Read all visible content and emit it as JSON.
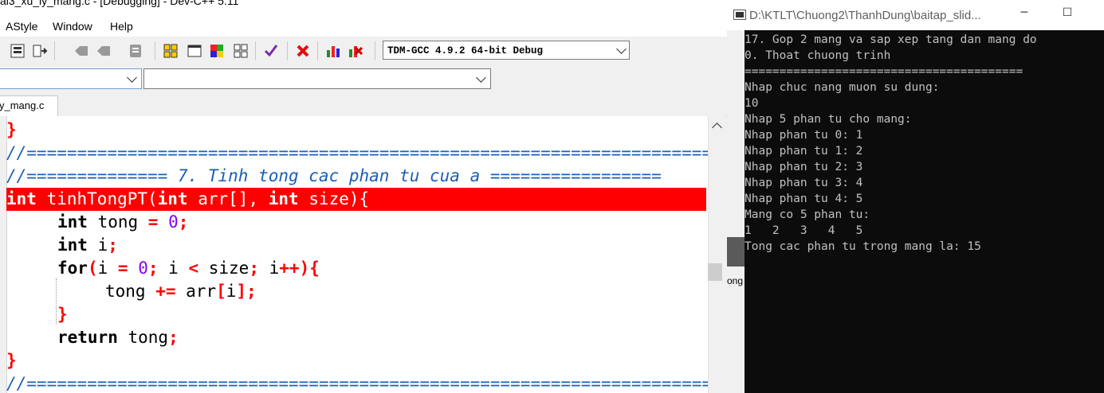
{
  "ide": {
    "title": "ai3_xu_ly_mang.c - [Debugging] - Dev-C++ 5.11",
    "minimize_icon": "minimize-icon",
    "maximize_icon": "maximize-icon",
    "close_icon": "close-icon",
    "menu": [
      "AStyle",
      "Window",
      "Help"
    ],
    "compiler": "TDM-GCC 4.9.2 64-bit Debug",
    "tab_label": "y_mang.c",
    "code": {
      "l0": "}",
      "l1": "//=====================================================================",
      "l2_pre": "//============== 7. Tinh tong cac phan tu cua a ",
      "l2_post": "=================",
      "l3_kw1": "int",
      "l3_fn": " tinhTongPT(",
      "l3_kw2": "int",
      "l3_arr": " arr[], ",
      "l3_kw3": "int",
      "l3_rest": " size){",
      "l4_kw": "int",
      "l4_var": " tong ",
      "l4_op": "=",
      "l4_num": "0",
      "l4_semi": ";",
      "l5_kw": "int",
      "l5_var": " i",
      "l5_semi": ";",
      "l6_kw": "for",
      "l6_p1": "(",
      "l6_i": "i ",
      "l6_eq": "=",
      "l6_num": "0",
      "l6_s1": ";",
      "l6_i2": " i ",
      "l6_lt": "<",
      "l6_size": " size",
      "l6_s2": ";",
      "l6_i3": " i",
      "l6_pp": "++){",
      "l7_var": "tong ",
      "l7_op": "+=",
      "l7_arr": " arr",
      "l7_b1": "[",
      "l7_i": "i",
      "l7_b2": "];",
      "l8": "}",
      "l9_kw": "return",
      "l9_var": " tong",
      "l9_semi": ";",
      "l10": "}",
      "l11": "//====================================================================="
    }
  },
  "console": {
    "title": "D:\\KTLT\\Chuong2\\ThanhDung\\baitap_slid...",
    "lines": [
      "17. Gop 2 mang va sap xep tang dan mang do",
      "0. Thoat chuong trinh",
      "========================================",
      "Nhap chuc nang muon su dung:",
      "10",
      "Nhap 5 phan tu cho mang:",
      "Nhap phan tu 0: 1",
      "Nhap phan tu 1: 2",
      "Nhap phan tu 2: 3",
      "Nhap phan tu 3: 4",
      "Nhap phan tu 4: 5",
      "Mang co 5 phan tu:",
      "1   2   3   4   5",
      "Tong cac phan tu trong mang la: 15"
    ],
    "behind_text": "ong"
  },
  "colors": {
    "highlight": "#ff0000",
    "operator": "#ff0000",
    "number": "#8000ff",
    "comment": "#1a5fb4",
    "console_bg": "#0c0c0c",
    "console_fg": "#c0c0c0"
  }
}
